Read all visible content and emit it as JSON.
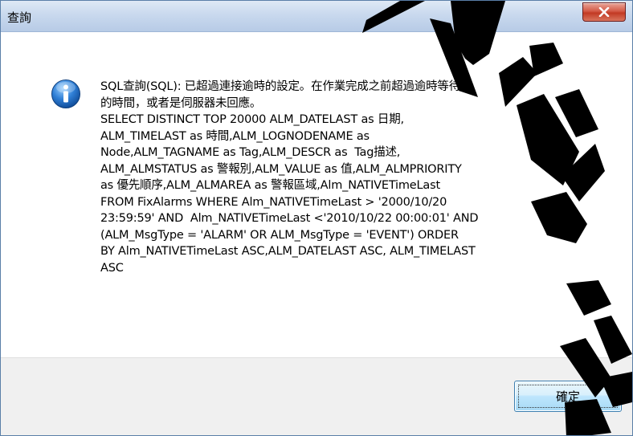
{
  "window": {
    "title": "查詢",
    "close_glyph": "x"
  },
  "dialog": {
    "icon": "info-icon",
    "message": "SQL查詢(SQL): 已超過連接逾時的設定。在作業完成之前超過逾時等待\n的時間，或者是伺服器未回應。\nSELECT DISTINCT TOP 20000 ALM_DATELAST as 日期,\nALM_TIMELAST as 時間,ALM_LOGNODENAME as\nNode,ALM_TAGNAME as Tag,ALM_DESCR as  Tag描述,\nALM_ALMSTATUS as 警報別,ALM_VALUE as 值,ALM_ALMPRIORITY\nas 優先順序,ALM_ALMAREA as 警報區域,Alm_NATIVETimeLast\nFROM FixAlarms WHERE Alm_NATIVETimeLast > '2000/10/20\n23:59:59' AND  Alm_NATIVETimeLast <'2010/10/22 00:00:01' AND\n(ALM_MsgType = 'ALARM' OR ALM_MsgType = 'EVENT') ORDER\nBY Alm_NATIVETimeLast ASC,ALM_DATELAST ASC, ALM_TIMELAST\nASC",
    "ok_label": "確定"
  },
  "colors": {
    "watermark": "#000000",
    "close_button": "#c23a24",
    "ok_border": "#3c7fb1"
  }
}
